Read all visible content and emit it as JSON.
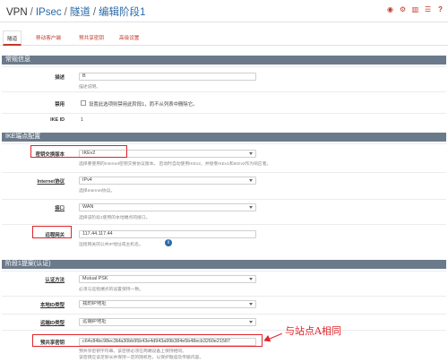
{
  "header": {
    "crumbs": [
      "VPN",
      "IPsec",
      "隧道",
      "编辑阶段1"
    ],
    "icons": [
      "record-icon",
      "gear-icon",
      "chart-icon",
      "list-icon",
      "help-icon"
    ]
  },
  "tabs": [
    "隧道",
    "移动客户端",
    "预共享密钥",
    "高级设置"
  ],
  "general": {
    "title": "常规信息",
    "desc_label": "描述",
    "desc_value": "B",
    "desc_help": "描述说明。",
    "disable_label": "禁用",
    "disable_text": "设置此选项则禁用此阶段1，而不从列表中删除它。",
    "ikeid_label": "IKE ID",
    "ikeid_value": "1"
  },
  "ike": {
    "title": "IKE端点配置",
    "kx_label": "密钥交换版本",
    "kx_value": "IKEv2",
    "kx_help": "选择要使用的Internet密钥交换协议版本。 启动时自动使用IKEv2，并接受IKEv1和IKEv2作为响应者。",
    "proto_label": "Internet协议",
    "proto_value": "IPv4",
    "proto_help": "选择Internet协议。",
    "iface_label": "接口",
    "iface_value": "WAN",
    "iface_help": "选择该阶段1使用的本地端点的接口。",
    "gw_label": "远程网关",
    "gw_value": "117.44.117.44",
    "gw_help": "远程网关的公共IP地址或主机名。"
  },
  "auth": {
    "title": "阶段1提案(认证)",
    "method_label": "认证方法",
    "method_value": "Mutual PSK",
    "method_help": "必须与远程端点的设置保持一致。",
    "myid_label": "本地ID类型",
    "myid_value": "我的IP地址",
    "peerid_label": "远端ID类型",
    "peerid_value": "远端IP地址",
    "psk_label": "预共享密钥",
    "psk_value": "c64c84bc98ec3bfa30bb95b43e4d943a99b384e5b48ecb3260e21587",
    "psk_help1": "预共享密钥字符串。该密钥必须在两端设备上保持相同。",
    "psk_help2": "该密钥应该足够长并保持一定的随机性，以保护隧道及传输内容。"
  },
  "annotation": "与站点A相同"
}
